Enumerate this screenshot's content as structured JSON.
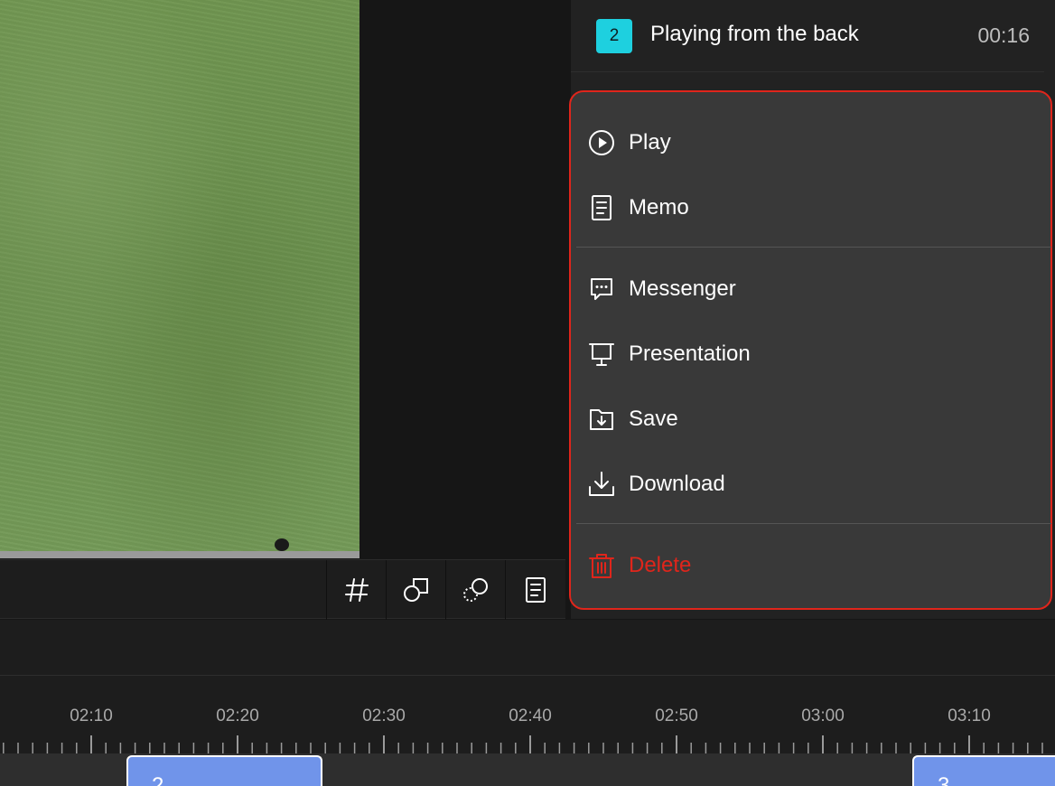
{
  "playlist_item": {
    "number": "2",
    "title": "Playing from the back",
    "time": "00:16"
  },
  "menu": {
    "play": "Play",
    "memo": "Memo",
    "messenger": "Messenger",
    "presentation": "Presentation",
    "save": "Save",
    "download": "Download",
    "delete": "Delete"
  },
  "toolbar": {
    "icons": [
      "hash-icon",
      "shapes-icon",
      "circle-select-icon",
      "memo-icon"
    ]
  },
  "timeline": {
    "ticks": [
      "02:10",
      "02:20",
      "02:30",
      "02:40",
      "02:50",
      "03:00",
      "03:10"
    ],
    "clips": [
      {
        "label": "2"
      },
      {
        "label": "3"
      }
    ]
  },
  "colors": {
    "accent": "#1ed0df",
    "danger": "#e0251b",
    "clip": "#7094ea"
  }
}
